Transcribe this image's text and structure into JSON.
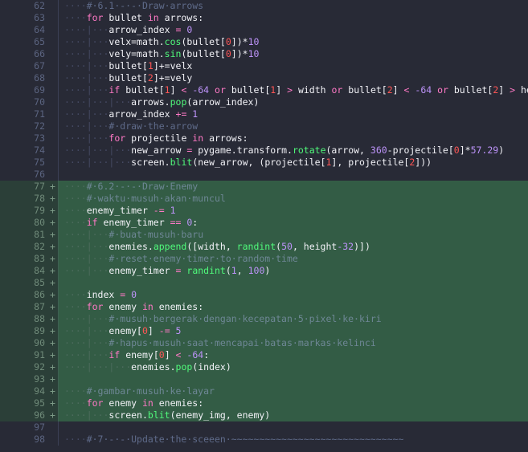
{
  "editor": {
    "theme": "dark-dracula-like",
    "language": "python",
    "colors": {
      "background": "#282a36",
      "added_line_background": "#335c45",
      "gutter_added_background": "#2b3f38",
      "line_number": "#5b6480",
      "comment": "#5f6b8a",
      "keyword": "#ff79c6",
      "function": "#50fa7b",
      "number": "#bd93f9",
      "number_alt": "#ff5555",
      "plain_text": "#f2f2f7",
      "indent_guide": "#454a63"
    },
    "first_visible_line": 62,
    "last_visible_line": 98,
    "diff_added_range": "77-96"
  },
  "lines": [
    {
      "n": "62",
      "marker": "",
      "added": false,
      "tokens": [
        {
          "t": "ws",
          "v": "····"
        },
        {
          "t": "cmt",
          "v": "#·6.1·-·-·Draw·arrows"
        }
      ]
    },
    {
      "n": "63",
      "marker": "",
      "added": false,
      "tokens": [
        {
          "t": "ws",
          "v": "····"
        },
        {
          "t": "kw",
          "v": "for"
        },
        {
          "t": "id",
          "v": " bullet "
        },
        {
          "t": "kw",
          "v": "in"
        },
        {
          "t": "id",
          "v": " arrows:"
        }
      ]
    },
    {
      "n": "64",
      "marker": "",
      "added": false,
      "tokens": [
        {
          "t": "ws",
          "v": "····"
        },
        {
          "t": "guide",
          "v": "|"
        },
        {
          "t": "ws",
          "v": "···"
        },
        {
          "t": "id",
          "v": "arrow_index "
        },
        {
          "t": "op",
          "v": "="
        },
        {
          "t": "num",
          "v": " 0"
        }
      ]
    },
    {
      "n": "65",
      "marker": "",
      "added": false,
      "tokens": [
        {
          "t": "ws",
          "v": "····"
        },
        {
          "t": "guide",
          "v": "|"
        },
        {
          "t": "ws",
          "v": "···"
        },
        {
          "t": "id",
          "v": "velx=math."
        },
        {
          "t": "fn",
          "v": "cos"
        },
        {
          "t": "id",
          "v": "(bullet["
        },
        {
          "t": "numred",
          "v": "0"
        },
        {
          "t": "id",
          "v": "])*"
        },
        {
          "t": "num",
          "v": "10"
        }
      ]
    },
    {
      "n": "66",
      "marker": "",
      "added": false,
      "tokens": [
        {
          "t": "ws",
          "v": "····"
        },
        {
          "t": "guide",
          "v": "|"
        },
        {
          "t": "ws",
          "v": "···"
        },
        {
          "t": "id",
          "v": "vely=math."
        },
        {
          "t": "fn",
          "v": "sin"
        },
        {
          "t": "id",
          "v": "(bullet["
        },
        {
          "t": "numred",
          "v": "0"
        },
        {
          "t": "id",
          "v": "])*"
        },
        {
          "t": "num",
          "v": "10"
        }
      ]
    },
    {
      "n": "67",
      "marker": "",
      "added": false,
      "tokens": [
        {
          "t": "ws",
          "v": "····"
        },
        {
          "t": "guide",
          "v": "|"
        },
        {
          "t": "ws",
          "v": "···"
        },
        {
          "t": "id",
          "v": "bullet["
        },
        {
          "t": "numred",
          "v": "1"
        },
        {
          "t": "id",
          "v": "]+=velx"
        }
      ]
    },
    {
      "n": "68",
      "marker": "",
      "added": false,
      "tokens": [
        {
          "t": "ws",
          "v": "····"
        },
        {
          "t": "guide",
          "v": "|"
        },
        {
          "t": "ws",
          "v": "···"
        },
        {
          "t": "id",
          "v": "bullet["
        },
        {
          "t": "numred",
          "v": "2"
        },
        {
          "t": "id",
          "v": "]+=vely"
        }
      ]
    },
    {
      "n": "69",
      "marker": "",
      "added": false,
      "tokens": [
        {
          "t": "ws",
          "v": "····"
        },
        {
          "t": "guide",
          "v": "|"
        },
        {
          "t": "ws",
          "v": "···"
        },
        {
          "t": "kw",
          "v": "if"
        },
        {
          "t": "id",
          "v": " bullet["
        },
        {
          "t": "numred",
          "v": "1"
        },
        {
          "t": "id",
          "v": "] "
        },
        {
          "t": "op",
          "v": "<"
        },
        {
          "t": "num",
          "v": " -64"
        },
        {
          "t": "kw",
          "v": " or"
        },
        {
          "t": "id",
          "v": " bullet["
        },
        {
          "t": "numred",
          "v": "1"
        },
        {
          "t": "id",
          "v": "] "
        },
        {
          "t": "op",
          "v": ">"
        },
        {
          "t": "id",
          "v": " width "
        },
        {
          "t": "kw",
          "v": "or"
        },
        {
          "t": "id",
          "v": " bullet["
        },
        {
          "t": "numred",
          "v": "2"
        },
        {
          "t": "id",
          "v": "] "
        },
        {
          "t": "op",
          "v": "<"
        },
        {
          "t": "num",
          "v": " -64"
        },
        {
          "t": "kw",
          "v": " or"
        },
        {
          "t": "id",
          "v": " bullet["
        },
        {
          "t": "numred",
          "v": "2"
        },
        {
          "t": "id",
          "v": "] "
        },
        {
          "t": "op",
          "v": ">"
        },
        {
          "t": "id",
          "v": " height:"
        }
      ]
    },
    {
      "n": "70",
      "marker": "",
      "added": false,
      "tokens": [
        {
          "t": "ws",
          "v": "····"
        },
        {
          "t": "guide",
          "v": "|"
        },
        {
          "t": "ws",
          "v": "···"
        },
        {
          "t": "guide",
          "v": "|"
        },
        {
          "t": "ws",
          "v": "···"
        },
        {
          "t": "id",
          "v": "arrows."
        },
        {
          "t": "fn",
          "v": "pop"
        },
        {
          "t": "id",
          "v": "(arrow_index)"
        }
      ]
    },
    {
      "n": "71",
      "marker": "",
      "added": false,
      "tokens": [
        {
          "t": "ws",
          "v": "····"
        },
        {
          "t": "guide",
          "v": "|"
        },
        {
          "t": "ws",
          "v": "···"
        },
        {
          "t": "id",
          "v": "arrow_index "
        },
        {
          "t": "op",
          "v": "+="
        },
        {
          "t": "num",
          "v": " 1"
        }
      ]
    },
    {
      "n": "72",
      "marker": "",
      "added": false,
      "tokens": [
        {
          "t": "ws",
          "v": "····"
        },
        {
          "t": "guide",
          "v": "|"
        },
        {
          "t": "ws",
          "v": "···"
        },
        {
          "t": "cmt",
          "v": "#·draw·the·arrow"
        }
      ]
    },
    {
      "n": "73",
      "marker": "",
      "added": false,
      "tokens": [
        {
          "t": "ws",
          "v": "····"
        },
        {
          "t": "guide",
          "v": "|"
        },
        {
          "t": "ws",
          "v": "···"
        },
        {
          "t": "kw",
          "v": "for"
        },
        {
          "t": "id",
          "v": " projectile "
        },
        {
          "t": "kw",
          "v": "in"
        },
        {
          "t": "id",
          "v": " arrows:"
        }
      ]
    },
    {
      "n": "74",
      "marker": "",
      "added": false,
      "tokens": [
        {
          "t": "ws",
          "v": "····"
        },
        {
          "t": "guide",
          "v": "|"
        },
        {
          "t": "ws",
          "v": "···"
        },
        {
          "t": "guide",
          "v": "|"
        },
        {
          "t": "ws",
          "v": "···"
        },
        {
          "t": "id",
          "v": "new_arrow "
        },
        {
          "t": "op",
          "v": "="
        },
        {
          "t": "id",
          "v": " pygame.transform."
        },
        {
          "t": "fn",
          "v": "rotate"
        },
        {
          "t": "id",
          "v": "(arrow, "
        },
        {
          "t": "num",
          "v": "360"
        },
        {
          "t": "id",
          "v": "-projectile["
        },
        {
          "t": "numred",
          "v": "0"
        },
        {
          "t": "id",
          "v": "]*"
        },
        {
          "t": "num",
          "v": "57.29"
        },
        {
          "t": "id",
          "v": ")"
        }
      ]
    },
    {
      "n": "75",
      "marker": "",
      "added": false,
      "tokens": [
        {
          "t": "ws",
          "v": "····"
        },
        {
          "t": "guide",
          "v": "|"
        },
        {
          "t": "ws",
          "v": "···"
        },
        {
          "t": "guide",
          "v": "|"
        },
        {
          "t": "ws",
          "v": "···"
        },
        {
          "t": "id",
          "v": "screen."
        },
        {
          "t": "fn",
          "v": "blit"
        },
        {
          "t": "id",
          "v": "(new_arrow, (projectile["
        },
        {
          "t": "numred",
          "v": "1"
        },
        {
          "t": "id",
          "v": "], projectile["
        },
        {
          "t": "numred",
          "v": "2"
        },
        {
          "t": "id",
          "v": "]))"
        }
      ]
    },
    {
      "n": "76",
      "marker": "",
      "added": false,
      "tokens": []
    },
    {
      "n": "77",
      "marker": "+",
      "added": true,
      "tokens": [
        {
          "t": "ws",
          "v": "····"
        },
        {
          "t": "cmt",
          "v": "#·6.2·-·-·Draw·Enemy"
        }
      ]
    },
    {
      "n": "78",
      "marker": "+",
      "added": true,
      "tokens": [
        {
          "t": "ws",
          "v": "····"
        },
        {
          "t": "cmt",
          "v": "#·waktu·musuh·akan·muncul"
        }
      ]
    },
    {
      "n": "79",
      "marker": "+",
      "added": true,
      "tokens": [
        {
          "t": "ws",
          "v": "····"
        },
        {
          "t": "id",
          "v": "enemy_timer "
        },
        {
          "t": "op",
          "v": "-="
        },
        {
          "t": "num",
          "v": " 1"
        }
      ]
    },
    {
      "n": "80",
      "marker": "+",
      "added": true,
      "tokens": [
        {
          "t": "ws",
          "v": "····"
        },
        {
          "t": "kw",
          "v": "if"
        },
        {
          "t": "id",
          "v": " enemy_timer "
        },
        {
          "t": "op",
          "v": "=="
        },
        {
          "t": "num",
          "v": " 0"
        },
        {
          "t": "id",
          "v": ":"
        }
      ]
    },
    {
      "n": "81",
      "marker": "+",
      "added": true,
      "tokens": [
        {
          "t": "ws",
          "v": "····"
        },
        {
          "t": "guide",
          "v": "|"
        },
        {
          "t": "ws",
          "v": "···"
        },
        {
          "t": "cmt",
          "v": "#·buat·musuh·baru"
        }
      ]
    },
    {
      "n": "82",
      "marker": "+",
      "added": true,
      "tokens": [
        {
          "t": "ws",
          "v": "····"
        },
        {
          "t": "guide",
          "v": "|"
        },
        {
          "t": "ws",
          "v": "···"
        },
        {
          "t": "id",
          "v": "enemies."
        },
        {
          "t": "fn",
          "v": "append"
        },
        {
          "t": "id",
          "v": "([width, "
        },
        {
          "t": "fn",
          "v": "randint"
        },
        {
          "t": "id",
          "v": "("
        },
        {
          "t": "num",
          "v": "50"
        },
        {
          "t": "id",
          "v": ", height"
        },
        {
          "t": "num",
          "v": "-32"
        },
        {
          "t": "id",
          "v": ")])"
        }
      ]
    },
    {
      "n": "83",
      "marker": "+",
      "added": true,
      "tokens": [
        {
          "t": "ws",
          "v": "····"
        },
        {
          "t": "guide",
          "v": "|"
        },
        {
          "t": "ws",
          "v": "···"
        },
        {
          "t": "cmt",
          "v": "#·reset·enemy·timer·to·random·time"
        }
      ]
    },
    {
      "n": "84",
      "marker": "+",
      "added": true,
      "tokens": [
        {
          "t": "ws",
          "v": "····"
        },
        {
          "t": "guide",
          "v": "|"
        },
        {
          "t": "ws",
          "v": "···"
        },
        {
          "t": "id",
          "v": "enemy_timer "
        },
        {
          "t": "op",
          "v": "="
        },
        {
          "t": "id",
          "v": " "
        },
        {
          "t": "fn",
          "v": "randint"
        },
        {
          "t": "id",
          "v": "("
        },
        {
          "t": "num",
          "v": "1"
        },
        {
          "t": "id",
          "v": ", "
        },
        {
          "t": "num",
          "v": "100"
        },
        {
          "t": "id",
          "v": ")"
        }
      ]
    },
    {
      "n": "85",
      "marker": "+",
      "added": true,
      "tokens": []
    },
    {
      "n": "86",
      "marker": "+",
      "added": true,
      "tokens": [
        {
          "t": "ws",
          "v": "····"
        },
        {
          "t": "id",
          "v": "index "
        },
        {
          "t": "op",
          "v": "="
        },
        {
          "t": "num",
          "v": " 0"
        }
      ]
    },
    {
      "n": "87",
      "marker": "+",
      "added": true,
      "tokens": [
        {
          "t": "ws",
          "v": "····"
        },
        {
          "t": "kw",
          "v": "for"
        },
        {
          "t": "id",
          "v": " enemy "
        },
        {
          "t": "kw",
          "v": "in"
        },
        {
          "t": "id",
          "v": " enemies:"
        }
      ]
    },
    {
      "n": "88",
      "marker": "+",
      "added": true,
      "tokens": [
        {
          "t": "ws",
          "v": "····"
        },
        {
          "t": "guide",
          "v": "|"
        },
        {
          "t": "ws",
          "v": "···"
        },
        {
          "t": "cmt",
          "v": "#·musuh·bergerak·dengan·kecepatan·5·pixel·ke·kiri"
        }
      ]
    },
    {
      "n": "89",
      "marker": "+",
      "added": true,
      "tokens": [
        {
          "t": "ws",
          "v": "····"
        },
        {
          "t": "guide",
          "v": "|"
        },
        {
          "t": "ws",
          "v": "···"
        },
        {
          "t": "id",
          "v": "enemy["
        },
        {
          "t": "numred",
          "v": "0"
        },
        {
          "t": "id",
          "v": "] "
        },
        {
          "t": "op",
          "v": "-="
        },
        {
          "t": "num",
          "v": " 5"
        }
      ]
    },
    {
      "n": "90",
      "marker": "+",
      "added": true,
      "tokens": [
        {
          "t": "ws",
          "v": "····"
        },
        {
          "t": "guide",
          "v": "|"
        },
        {
          "t": "ws",
          "v": "···"
        },
        {
          "t": "cmt",
          "v": "#·hapus·musuh·saat·mencapai·batas·markas·kelinci"
        }
      ]
    },
    {
      "n": "91",
      "marker": "+",
      "added": true,
      "tokens": [
        {
          "t": "ws",
          "v": "····"
        },
        {
          "t": "guide",
          "v": "|"
        },
        {
          "t": "ws",
          "v": "···"
        },
        {
          "t": "kw",
          "v": "if"
        },
        {
          "t": "id",
          "v": " enemy["
        },
        {
          "t": "numred",
          "v": "0"
        },
        {
          "t": "id",
          "v": "] "
        },
        {
          "t": "op",
          "v": "<"
        },
        {
          "t": "num",
          "v": " -64"
        },
        {
          "t": "id",
          "v": ":"
        }
      ]
    },
    {
      "n": "92",
      "marker": "+",
      "added": true,
      "tokens": [
        {
          "t": "ws",
          "v": "····"
        },
        {
          "t": "guide",
          "v": "|"
        },
        {
          "t": "ws",
          "v": "···"
        },
        {
          "t": "guide",
          "v": "|"
        },
        {
          "t": "ws",
          "v": "···"
        },
        {
          "t": "id",
          "v": "enemies."
        },
        {
          "t": "fn",
          "v": "pop"
        },
        {
          "t": "id",
          "v": "(index)"
        }
      ]
    },
    {
      "n": "93",
      "marker": "+",
      "added": true,
      "tokens": []
    },
    {
      "n": "94",
      "marker": "+",
      "added": true,
      "tokens": [
        {
          "t": "ws",
          "v": "····"
        },
        {
          "t": "cmt",
          "v": "#·gambar·musuh·ke·layar"
        }
      ]
    },
    {
      "n": "95",
      "marker": "+",
      "added": true,
      "tokens": [
        {
          "t": "ws",
          "v": "····"
        },
        {
          "t": "kw",
          "v": "for"
        },
        {
          "t": "id",
          "v": " enemy "
        },
        {
          "t": "kw",
          "v": "in"
        },
        {
          "t": "id",
          "v": " enemies:"
        }
      ]
    },
    {
      "n": "96",
      "marker": "+",
      "added": true,
      "tokens": [
        {
          "t": "ws",
          "v": "····"
        },
        {
          "t": "guide",
          "v": "|"
        },
        {
          "t": "ws",
          "v": "···"
        },
        {
          "t": "id",
          "v": "screen."
        },
        {
          "t": "fn",
          "v": "blit"
        },
        {
          "t": "id",
          "v": "(enemy_img, enemy)"
        }
      ]
    },
    {
      "n": "97",
      "marker": "",
      "added": false,
      "tokens": []
    },
    {
      "n": "98",
      "marker": "",
      "added": false,
      "tokens": [
        {
          "t": "ws",
          "v": "····"
        },
        {
          "t": "cmt",
          "v": "#·7·-·-·Update·the·sceeen·~~~~~~~~~~~~~~~~~~~~~~~~~~~~~~~"
        }
      ]
    }
  ]
}
